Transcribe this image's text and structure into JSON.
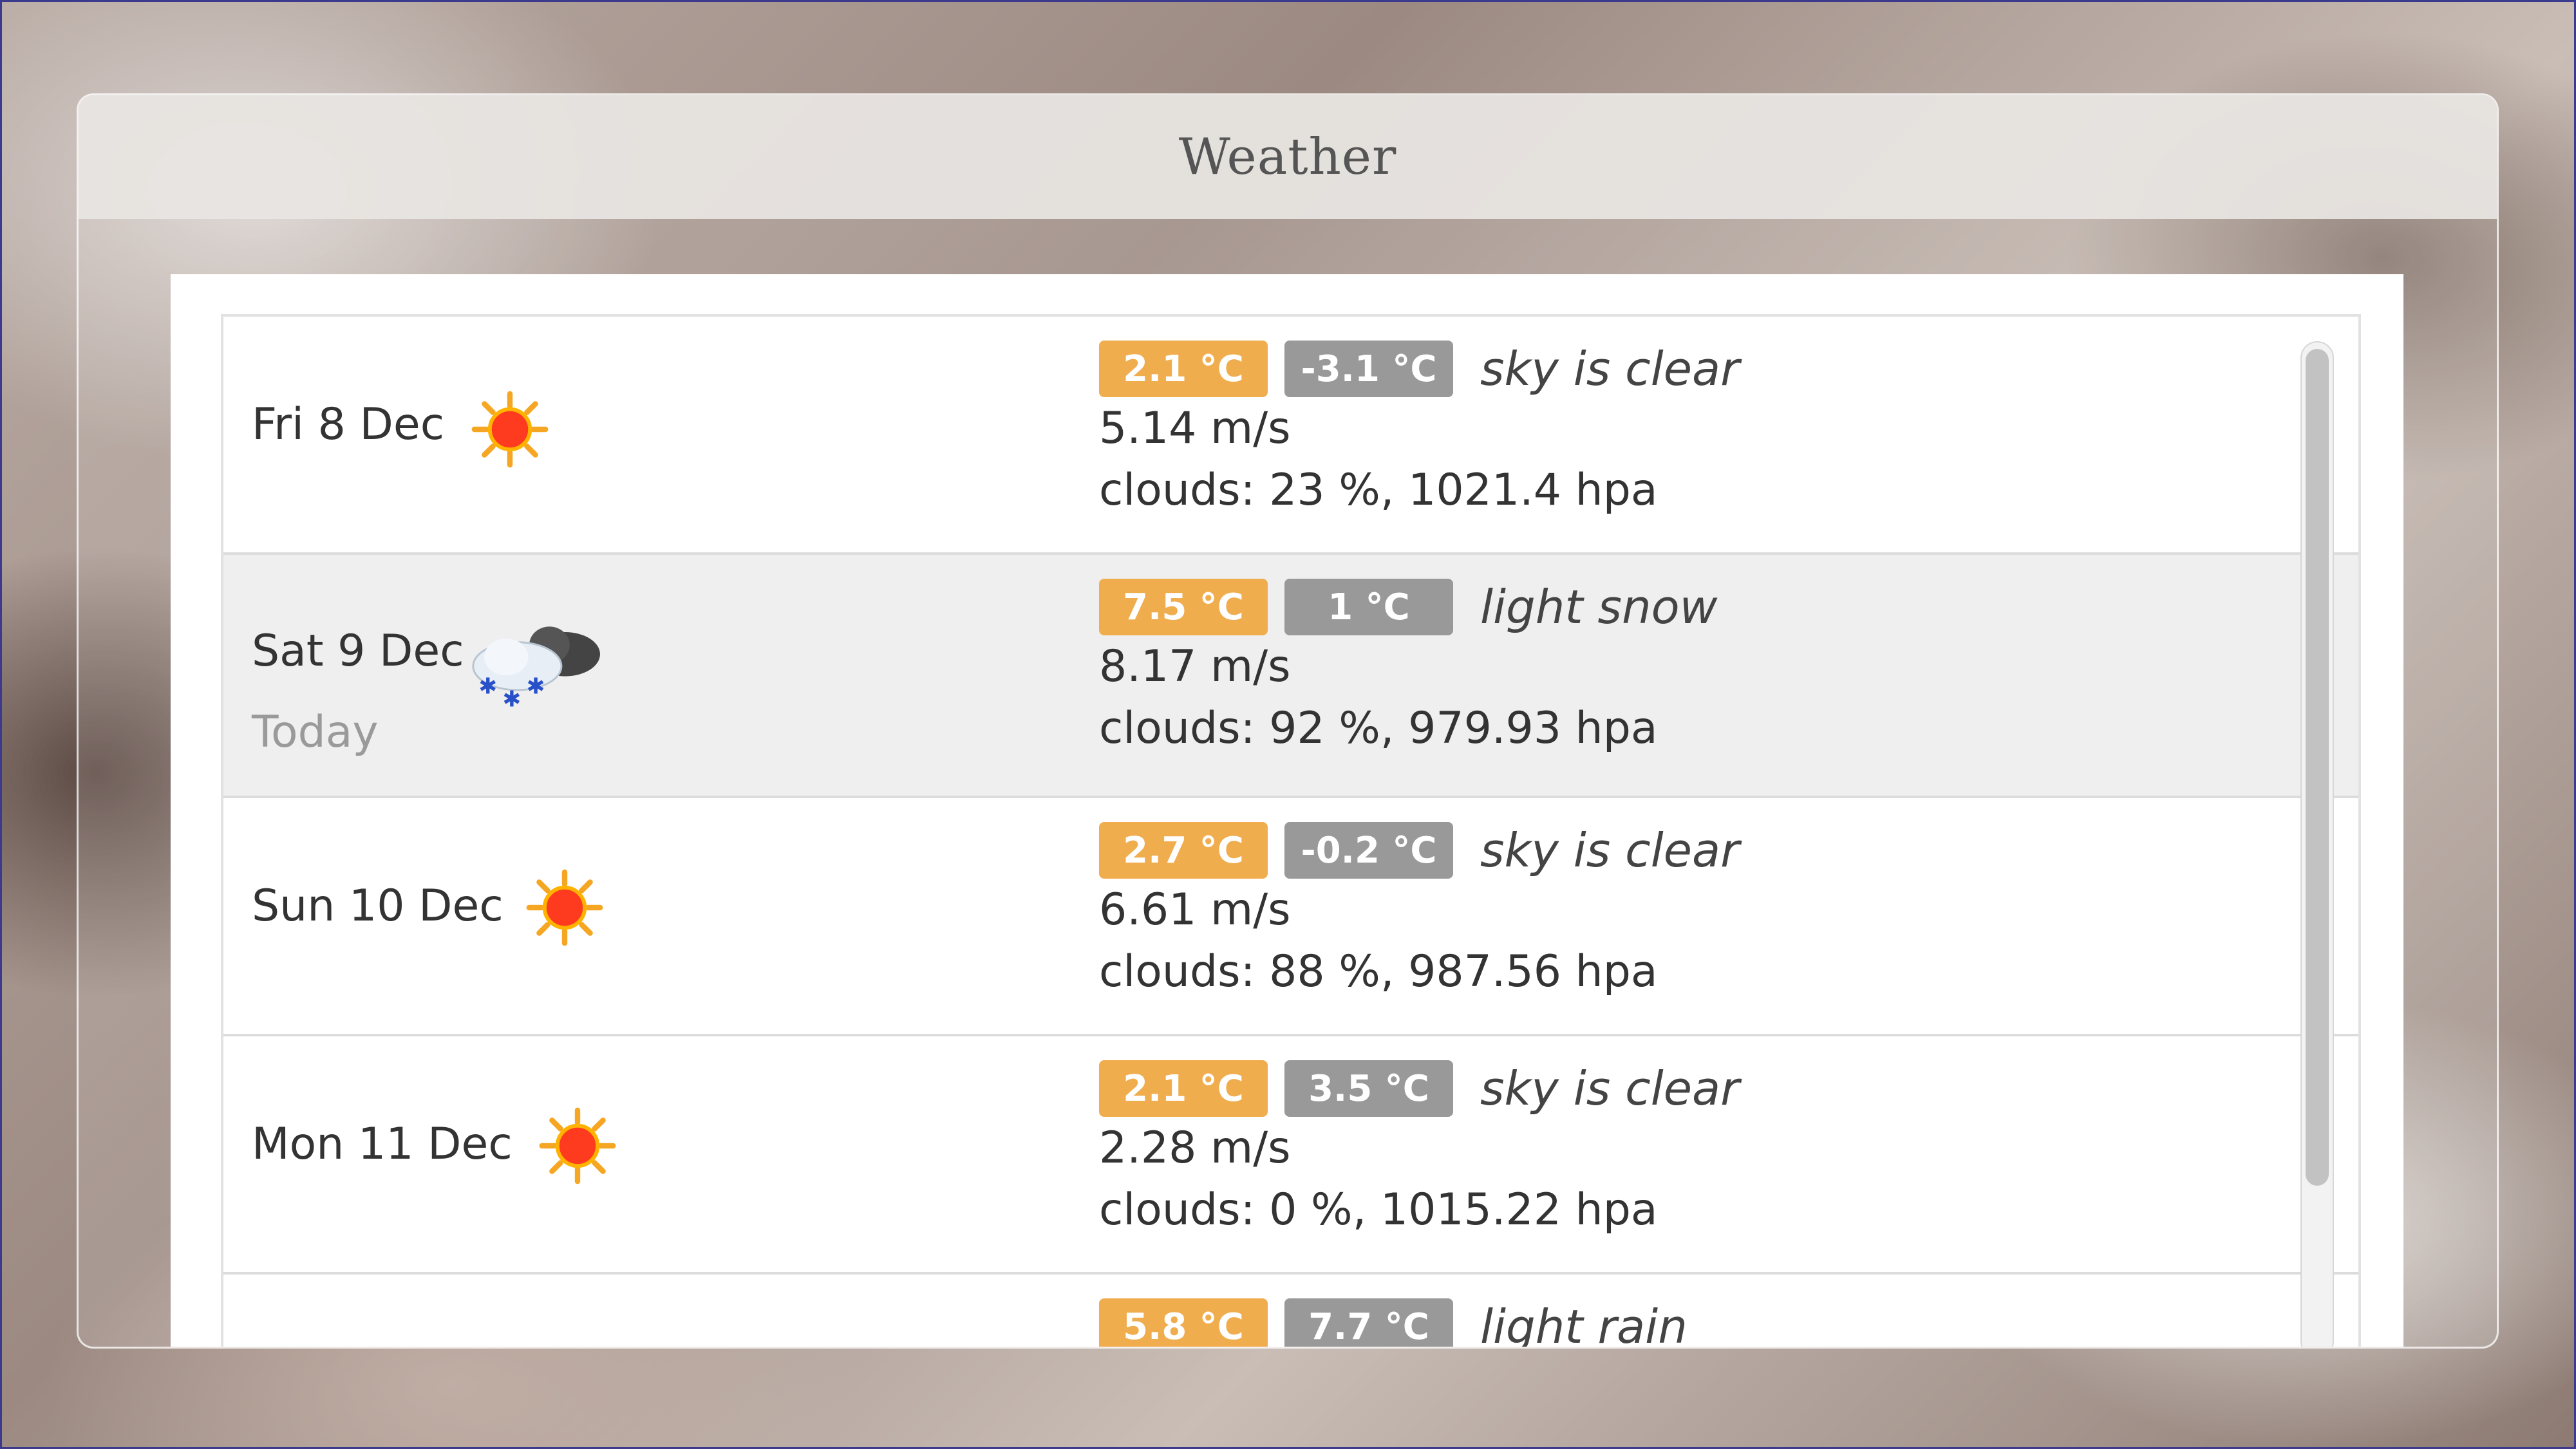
{
  "app": {
    "title": "Weather"
  },
  "forecast": [
    {
      "day": "Fri 8 Dec",
      "icon": "sun-icon",
      "today_label": "",
      "max": "2.1 °C",
      "min": "-3.1 °C",
      "description": "sky is clear",
      "wind": "5.14 m/s",
      "clouds": "clouds: 23 %,  1021.4 hpa"
    },
    {
      "day": "Sat 9 Dec",
      "icon": "snow-cloud-icon",
      "today_label": "Today",
      "max": "7.5 °C",
      "min": "1 °C",
      "description": "light snow",
      "wind": "8.17 m/s",
      "clouds": "clouds: 92 %,  979.93 hpa"
    },
    {
      "day": "Sun 10 Dec",
      "icon": "sun-icon",
      "today_label": "",
      "max": "2.7 °C",
      "min": "-0.2 °C",
      "description": "sky is clear",
      "wind": "6.61 m/s",
      "clouds": "clouds: 88 %,  987.56 hpa"
    },
    {
      "day": "Mon 11 Dec",
      "icon": "sun-icon",
      "today_label": "",
      "max": "2.1 °C",
      "min": "3.5 °C",
      "description": "sky is clear",
      "wind": "2.28 m/s",
      "clouds": "clouds: 0 %,  1015.22 hpa"
    },
    {
      "day": "",
      "icon": "",
      "today_label": "",
      "max": "5.8 °C",
      "min": "7.7 °C",
      "description": "light rain",
      "wind": "",
      "clouds": ""
    }
  ],
  "colors": {
    "max_badge": "#f0ad4e",
    "min_badge": "#999999",
    "today_row": "#efefef"
  }
}
